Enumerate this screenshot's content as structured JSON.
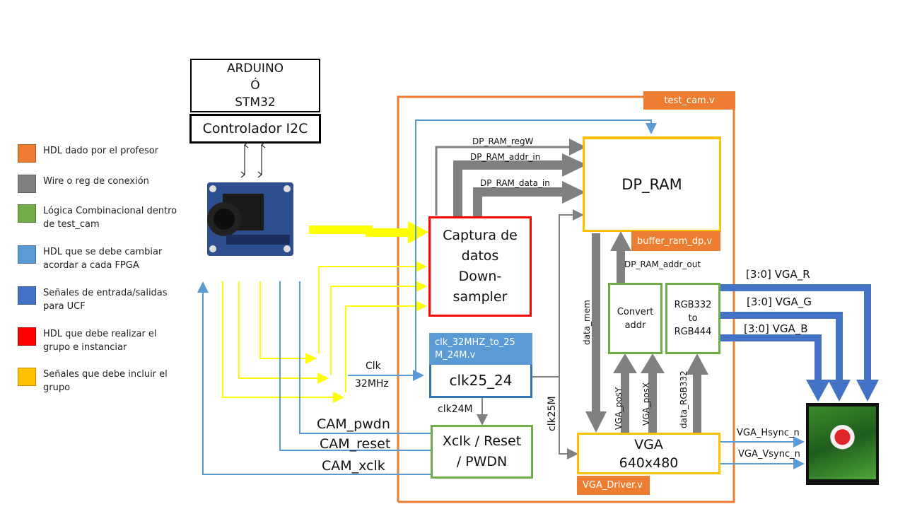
{
  "legend": [
    {
      "color": "#ED7D31",
      "label": "HDL dado por el profesor"
    },
    {
      "color": "#808080",
      "label": "Wire o reg  de conexión"
    },
    {
      "color": "#70AD47",
      "label": "Lógica Combinacional  dentro de test_cam"
    },
    {
      "color": "#5B9BD5",
      "label": "HDL que se debe cambiar acordar a cada FPGA"
    },
    {
      "color": "#4472C4",
      "label": "Señales de entrada/salidas para UCF"
    },
    {
      "color": "#FF0000",
      "label": "HDL que debe realizar el grupo e instanciar"
    },
    {
      "color": "#FFC000",
      "label": "Señales que debe incluir el grupo"
    }
  ],
  "controller": {
    "line1": "ARDUINO",
    "line2": "Ó",
    "line3": "STM32",
    "i2c": "Controlador I2C"
  },
  "top_module": {
    "name": "test_cam.v"
  },
  "blocks": {
    "dp_ram": {
      "label": "DP_RAM",
      "file": "buffer_ram_dp,v"
    },
    "capture": {
      "line1": "Captura de",
      "line2": "datos",
      "line3": "Down-",
      "line4": "sampler"
    },
    "clk": {
      "label": "clk25_24",
      "file_line1": "clk_32MHZ_to_25",
      "file_line2": "M_24M.v"
    },
    "xclk": {
      "line1": "Xclk / Reset",
      "line2": "/ PWDN"
    },
    "convert": {
      "line1": "Convert",
      "line2": "addr"
    },
    "rgb": {
      "line1": "RGB332",
      "line2": "to",
      "line3": "RGB444"
    },
    "vga": {
      "line1": "VGA",
      "line2": "640x480",
      "file": "VGA_Driver.v"
    }
  },
  "signals": {
    "regw": "DP_RAM_regW",
    "addr_in": "DP_RAM_addr_in",
    "data_in": "DP_RAM_data_in",
    "addr_out": "DP_RAM_addr_out",
    "data_mem": "data_mem",
    "clk25m": "clk25M",
    "clk24m": "clk24M",
    "clk_in_1": "Clk",
    "clk_in_2": "32MHz",
    "pwdn": "CAM_pwdn",
    "reset": "CAM_reset",
    "xclk": "CAM_xclk",
    "posy": "VGA_posY",
    "posx": "VGA_posX",
    "rgb332": "data_RGB332",
    "vga_r": "[3:0] VGA_R",
    "vga_g": "[3:0] VGA_G",
    "vga_b": "[3:0] VGA_B",
    "hsync": "VGA_Hsync_n",
    "vsync": "VGA_Vsync_n"
  },
  "colors": {
    "orange": "#ED7D31",
    "gray": "#808080",
    "green": "#70AD47",
    "light_blue": "#5B9BD5",
    "blue": "#4472C4",
    "red": "#FF0000",
    "yellow": "#FFC000",
    "bright_yellow": "#FFFF00"
  }
}
